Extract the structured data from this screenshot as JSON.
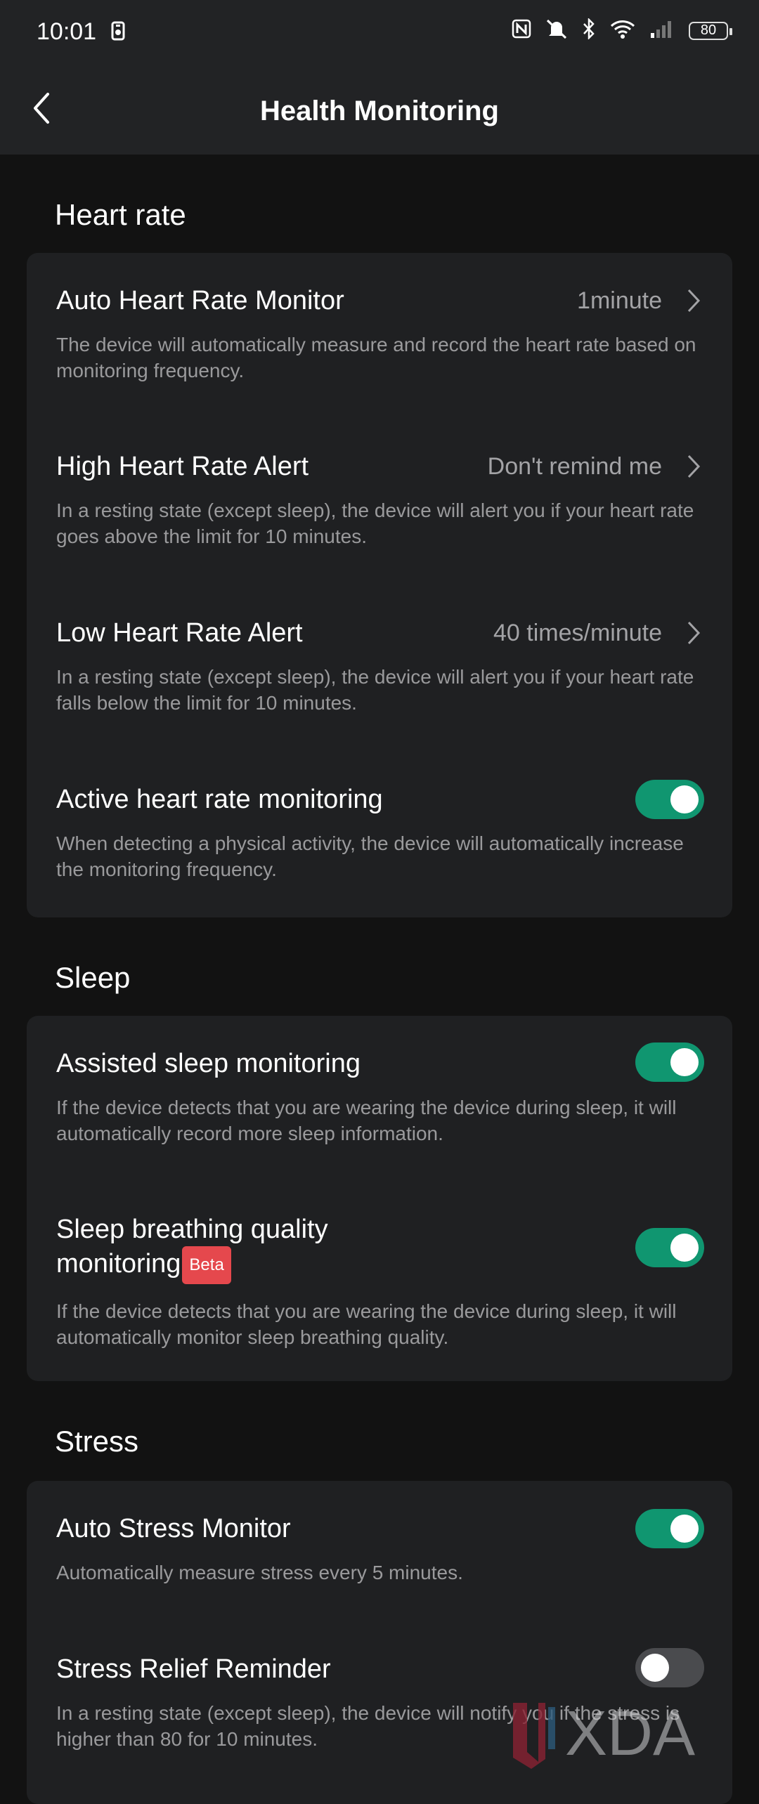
{
  "status_bar": {
    "time": "10:01",
    "battery": "80",
    "icons": [
      "nfc-icon",
      "mute-icon",
      "bluetooth-icon",
      "wifi-icon",
      "signal-icon",
      "battery-icon"
    ]
  },
  "header": {
    "title": "Health Monitoring",
    "back_icon": "chevron-left-icon"
  },
  "sections": {
    "heart_rate": {
      "title": "Heart rate",
      "auto_monitor": {
        "label": "Auto Heart Rate Monitor",
        "value": "1minute",
        "desc": "The device will automatically measure and record the heart rate based on monitoring frequency."
      },
      "high_alert": {
        "label": "High Heart Rate Alert",
        "value": "Don't remind me",
        "desc": "In a resting state (except sleep), the device will alert you if your heart rate goes above the limit for 10 minutes."
      },
      "low_alert": {
        "label": "Low Heart Rate Alert",
        "value": "40 times/minute",
        "desc": "In a resting state (except sleep), the device will alert you if your heart rate falls below the limit for 10 minutes."
      },
      "active_monitoring": {
        "label": "Active heart rate monitoring",
        "enabled": true,
        "desc": "When detecting a physical activity, the device will automatically increase the monitoring frequency."
      }
    },
    "sleep": {
      "title": "Sleep",
      "assisted": {
        "label": "Assisted sleep monitoring",
        "enabled": true,
        "desc": "If the device detects that you are wearing the device during sleep, it will automatically record more sleep information."
      },
      "breathing": {
        "label_line1": "Sleep breathing quality",
        "label_line2": "monitoring",
        "badge": "Beta",
        "enabled": true,
        "desc": "If the device detects that you are wearing the device during sleep, it will automatically monitor sleep breathing quality."
      }
    },
    "stress": {
      "title": "Stress",
      "auto_monitor": {
        "label": "Auto Stress Monitor",
        "enabled": true,
        "desc": "Automatically measure stress every 5 minutes."
      },
      "relief_reminder": {
        "label": "Stress Relief Reminder",
        "enabled": false,
        "desc": "In a resting state (except sleep), the device will notify you if the stress is higher than 80 for 10 minutes."
      }
    }
  },
  "watermark": {
    "text": "XDA"
  },
  "colors": {
    "toggle_on": "#109670",
    "toggle_off": "#4a4b4e",
    "badge": "#e5484d"
  }
}
